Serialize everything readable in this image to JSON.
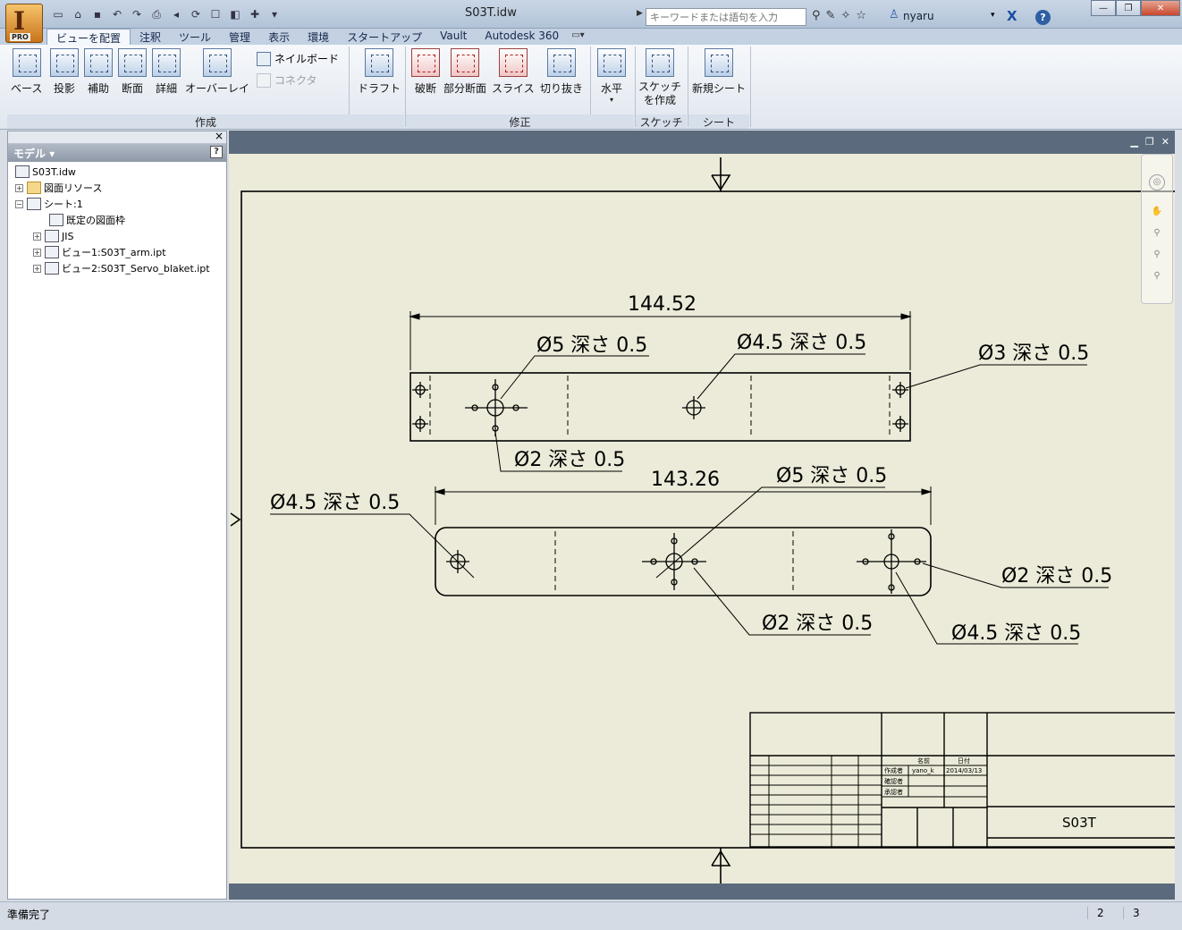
{
  "window": {
    "title": "S03T.idw",
    "search_placeholder": "キーワードまたは語句を入力",
    "user": "nyaru",
    "app_badge": "PRO"
  },
  "tabs": [
    {
      "label": "ビューを配置"
    },
    {
      "label": "注釈"
    },
    {
      "label": "ツール"
    },
    {
      "label": "管理"
    },
    {
      "label": "表示"
    },
    {
      "label": "環境"
    },
    {
      "label": "スタートアップ"
    },
    {
      "label": "Vault"
    },
    {
      "label": "Autodesk 360"
    }
  ],
  "ribbon": {
    "create": {
      "label": "作成",
      "base": "ベース",
      "projected": "投影",
      "auxiliary": "補助",
      "section": "断面",
      "detail": "詳細",
      "overlay": "オーバーレイ",
      "nailboard": "ネイルボード",
      "connector": "コネクタ"
    },
    "draft": "ドラフト",
    "modify": {
      "label": "修正",
      "break": "破断",
      "break_out": "部分断面",
      "slice": "スライス",
      "crop": "切り抜き",
      "horizontal": "水平"
    },
    "sketch": {
      "label": "スケッチ",
      "create_line1": "スケッチ",
      "create_line2": "を作成"
    },
    "sheet": {
      "label": "シート",
      "new_sheet": "新規シート"
    }
  },
  "browser": {
    "header": "モデル",
    "tree": [
      {
        "label": "S03T.idw"
      },
      {
        "label": "図面リソース"
      },
      {
        "label": "シート:1"
      },
      {
        "label": "既定の図面枠"
      },
      {
        "label": "JIS"
      },
      {
        "label": "ビュー1:S03T_arm.ipt"
      },
      {
        "label": "ビュー2:S03T_Servo_blaket.ipt"
      }
    ]
  },
  "drawing": {
    "dim_top_width": "144.52",
    "dim_bottom_width": "143.26",
    "top_callouts": {
      "hole5": "Ø5 深さ 0.5",
      "hole45": "Ø4.5 深さ 0.5",
      "hole3": "Ø3 深さ 0.5",
      "hole2": "Ø2 深さ 0.5"
    },
    "bottom_callouts": {
      "left45": "Ø4.5 深さ 0.5",
      "hole5": "Ø5 深さ 0.5",
      "right2": "Ø2 深さ 0.5",
      "mid2": "Ø2 深さ 0.5",
      "right45": "Ø4.5 深さ 0.5"
    },
    "title_block": {
      "col_name": "名前",
      "col_date": "日付",
      "author_label": "作成者",
      "author": "yano_k",
      "date": "2014/03/13",
      "checker_label": "確認者",
      "approver_label": "承認者",
      "drawing_title": "S03T"
    }
  },
  "status": {
    "text": "準備完了",
    "n1": "2",
    "n2": "3"
  },
  "colors": {
    "sheet_bg": "#ecebd9",
    "graphics_frame": "#5b6b7d"
  }
}
